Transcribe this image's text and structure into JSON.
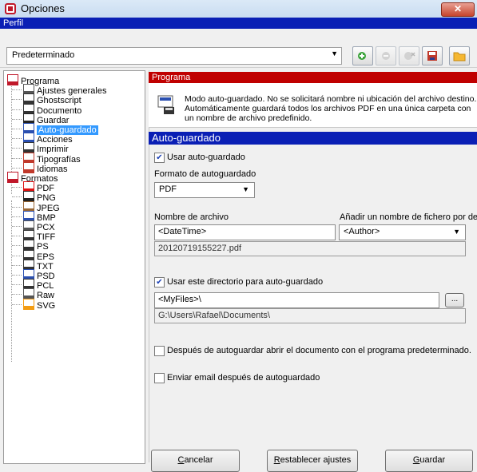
{
  "window": {
    "title": "Opciones",
    "close_label": "✕"
  },
  "profile": {
    "header_label": "Perfil",
    "selected": "Predeterminado"
  },
  "tree": {
    "items": [
      {
        "label": "Programa",
        "icon": "program-icon"
      },
      {
        "label": "Ajustes generales",
        "icon": "settings-icon"
      },
      {
        "label": "Ghostscript",
        "icon": "ghostscript-icon"
      },
      {
        "label": "Documento",
        "icon": "document-icon"
      },
      {
        "label": "Guardar",
        "icon": "save-icon"
      },
      {
        "label": "Auto-guardado",
        "icon": "autosave-icon"
      },
      {
        "label": "Acciones",
        "icon": "actions-icon"
      },
      {
        "label": "Imprimir",
        "icon": "print-icon"
      },
      {
        "label": "Tipografías",
        "icon": "fonts-icon"
      },
      {
        "label": "Idiomas",
        "icon": "languages-icon"
      },
      {
        "label": "Formatos",
        "icon": "formats-icon"
      },
      {
        "label": "PDF",
        "icon": "pdf-icon"
      },
      {
        "label": "PNG",
        "icon": "png-icon"
      },
      {
        "label": "JPEG",
        "icon": "jpeg-icon"
      },
      {
        "label": "BMP",
        "icon": "bmp-icon"
      },
      {
        "label": "PCX",
        "icon": "pcx-icon"
      },
      {
        "label": "TIFF",
        "icon": "tiff-icon"
      },
      {
        "label": "PS",
        "icon": "ps-icon"
      },
      {
        "label": "EPS",
        "icon": "eps-icon"
      },
      {
        "label": "TXT",
        "icon": "txt-icon"
      },
      {
        "label": "PSD",
        "icon": "psd-icon"
      },
      {
        "label": "PCL",
        "icon": "pcl-icon"
      },
      {
        "label": "Raw",
        "icon": "raw-icon"
      },
      {
        "label": "SVG",
        "icon": "svg-icon"
      }
    ],
    "selected": "Auto-guardado"
  },
  "section": {
    "header": "Programa",
    "description": [
      "Modo auto-guardado. No se solicitará nombre ni ubicación del archivo destino.",
      "Automáticamente guardará todos los archivos PDF en una única carpeta con",
      "un nombre de archivo predefinido."
    ],
    "panel_title": "Auto-guardado"
  },
  "form": {
    "use_autosave_label": "Usar auto-guardado",
    "use_autosave_checked": true,
    "format_label": "Formato de autoguardado",
    "format_value": "PDF",
    "filename_label": "Nombre de archivo",
    "filename_value": "<DateTime>",
    "add_name_label": "Añadir un nombre de fichero por defecto",
    "add_name_value": "<Author>",
    "filename_preview": "20120719155227.pdf",
    "use_dir_label": "Usar este directorio para auto-guardado",
    "use_dir_checked": true,
    "dir_value": "<MyFiles>\\",
    "browse_label": "...",
    "dir_preview": "G:\\Users\\Rafael\\Documents\\",
    "open_after_label": "Después de autoguardar abrir el documento con el programa predeterminado.",
    "open_after_checked": false,
    "email_after_label": "Enviar email después de autoguardado",
    "email_after_checked": false
  },
  "buttons": {
    "cancel_first": "C",
    "cancel_rest": "ancelar",
    "reset_first": "R",
    "reset_rest": "establecer ajustes",
    "save_first": "G",
    "save_rest": "uardar"
  }
}
